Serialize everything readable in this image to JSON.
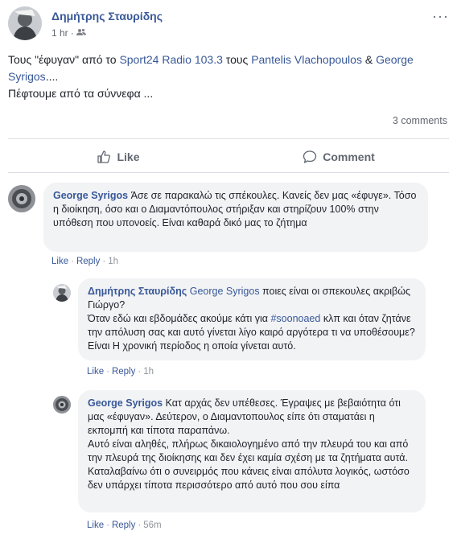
{
  "post": {
    "author": "Δημήτρης Σταυρίδης",
    "time": "1 hr",
    "audience_icon": "friends-icon",
    "more": "···",
    "text": {
      "part1": "Τους \"έφυγαν\" από το ",
      "link1": "Sport24 Radio 103.3",
      "part2": " τους ",
      "link2": "Pantelis Vlachopoulos",
      "part3": " & ",
      "link3": "George Syrigos",
      "part4": "....",
      "line2": "Πέφτουμε από τα σύννεφα ..."
    },
    "comments_count": "3 comments"
  },
  "actions": {
    "like": "Like",
    "comment": "Comment"
  },
  "comments": [
    {
      "author": "George Syrigos",
      "text": "Άσε σε παρακαλώ τις σπέκουλες. Κανείς δεν μας «έφυγε». Τόσο η διοίκηση, όσο και ο Διαμαντόπουλος στήριξαν και στηρίζουν 100% στην υπόθεση που υπονοείς. Είναι καθαρά δικό μας το ζήτημα",
      "like": "Like",
      "reply": "Reply",
      "time": "1h"
    },
    {
      "author": "Δημήτρης Σταυρίδης",
      "tag": "George Syrigos",
      "text1": " ποιες είναι οι σπεκουλες ακριβώς Γιώργο?",
      "text2a": "Όταν εδώ και εβδομάδες ακούμε κάτι για ",
      "hashtag": "#soonoaed",
      "text2b": " κλπ και όταν ζητάνε την απόλυση σας και αυτό γίνεται λίγο καιρό αργότερα τι να υποθέσουμε? Είναι Η χρονική περίοδος η οποία γίνεται αυτό.",
      "like": "Like",
      "reply": "Reply",
      "time": "1h"
    },
    {
      "author": "George Syrigos",
      "text1": " Κατ αρχάς δεν υπέθεσες. Έγραψες με βεβαιότητα ότι μας «έφυγαν». Δεύτερον, ο Διαμαντοπουλος είπε ότι σταματάει η εκπομπή και τίποτα παραπάνω.",
      "text2": "Αυτό είναι αληθές, πλήρως δικαιολογημένο από την πλευρά του και από την πλευρά της διοίκησης και δεν έχει καμία σχέση με τα ζητήματα αυτά. Καταλαβαίνω ότι ο συνειρμός που κάνεις είναι απόλυτα λογικός, ωστόσο δεν υπάρχει τίποτα περισσότερο από αυτό που σου είπα",
      "like": "Like",
      "reply": "Reply",
      "time": "56m"
    }
  ],
  "colors": {
    "link": "#385898",
    "bubble": "#f2f3f5",
    "muted": "#616770"
  }
}
